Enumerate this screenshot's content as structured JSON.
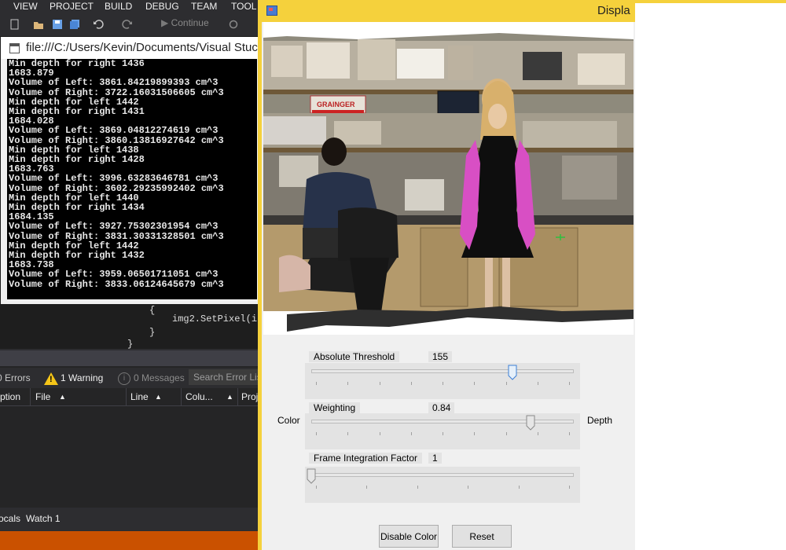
{
  "vs": {
    "menu": [
      "VIEW",
      "PROJECT",
      "BUILD",
      "DEBUG",
      "TEAM",
      "TOOL"
    ],
    "toolbar": {
      "continue_label": "Continue"
    },
    "console": {
      "title": "file:///C:/Users/Kevin/Documents/Visual Stuc",
      "lines": [
        "Min depth for right 1436",
        "1683.879",
        "Volume of Left: 3861.84219899393 cm^3",
        "Volume of Right: 3722.16031506605 cm^3",
        "Min depth for left 1442",
        "Min depth for right 1431",
        "1684.028",
        "Volume of Left: 3869.04812274619 cm^3",
        "Volume of Right: 3860.13816927642 cm^3",
        "Min depth for left 1438",
        "Min depth for right 1428",
        "1683.763",
        "Volume of Left: 3996.63283646781 cm^3",
        "Volume of Right: 3602.29235992402 cm^3",
        "Min depth for left 1440",
        "Min depth for right 1434",
        "1684.135",
        "Volume of Left: 3927.75302301954 cm^3",
        "Volume of Right: 3831.30331328501 cm^3",
        "Min depth for left 1442",
        "Min depth for right 1432",
        "1683.738",
        "Volume of Left: 3959.06501711051 cm^3",
        "Volume of Right: 3833.06124645679 cm^3"
      ]
    },
    "code": {
      "line1": "{",
      "line2": "img2.SetPixel(i,",
      "line3": "}",
      "line4": "}"
    },
    "error_list": {
      "errors": "0 Errors",
      "warnings": "1 Warning",
      "messages": "0 Messages",
      "search_placeholder": "Search Error Lis",
      "columns": [
        "ption",
        "File",
        "Line",
        "Colu...",
        "Proj"
      ]
    },
    "bottom_tabs": [
      "ocals",
      "Watch 1"
    ],
    "colors": {
      "status_bar": "#ca5100",
      "background": "#2d2d30"
    }
  },
  "display": {
    "title": "Displa",
    "threshold": {
      "label": "Absolute Threshold",
      "value": "155",
      "position": 0.77
    },
    "weighting": {
      "label": "Weighting",
      "value": "0.84",
      "position": 0.84,
      "left_label": "Color",
      "right_label": "Depth"
    },
    "integration": {
      "label": "Frame Integration Factor",
      "value": "1",
      "position": 0.0
    },
    "buttons": {
      "disable_color": "Disable Color",
      "reset": "Reset"
    },
    "scene": {
      "sign_text": "GRAINGER",
      "icon": "depth-camera-scene"
    },
    "colors": {
      "title_bar": "#f5d13c",
      "window": "#f0f0f0",
      "highlight_arms": "#d84fc4"
    }
  }
}
